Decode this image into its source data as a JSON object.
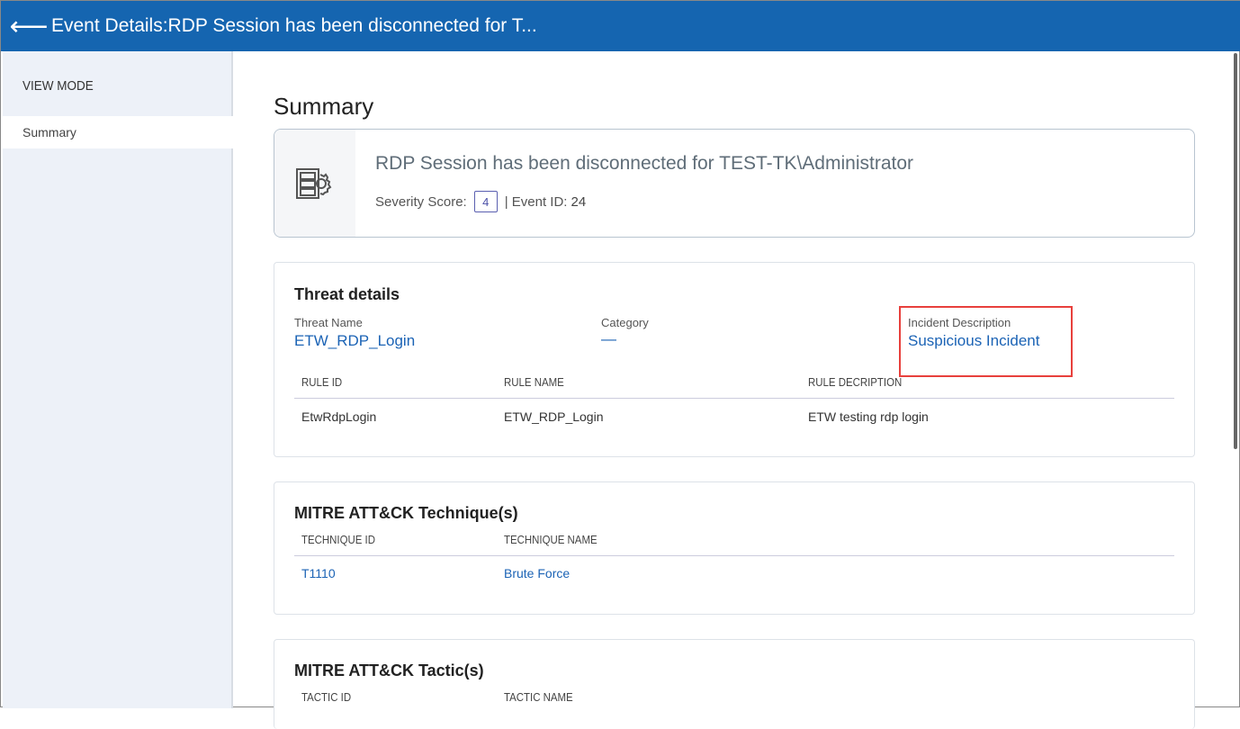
{
  "header": {
    "title": "Event Details:RDP Session has been disconnected for T...",
    "back_icon": "arrow-left-icon"
  },
  "sidebar": {
    "section": "VIEW MODE",
    "items": [
      {
        "label": "Summary"
      }
    ]
  },
  "summary": {
    "heading": "Summary",
    "event_title": "RDP Session has been disconnected for TEST-TK\\Administrator",
    "severity_label": "Severity Score:",
    "severity_value": "4",
    "event_id_label": "| Event ID:",
    "event_id": "24"
  },
  "threat": {
    "title": "Threat details",
    "threat_name_label": "Threat Name",
    "threat_name": "ETW_RDP_Login",
    "category_label": "Category",
    "category": "—",
    "incident_label": "Incident Description",
    "incident": "Suspicious Incident",
    "columns": [
      "RULE ID",
      "RULE NAME",
      "RULE DECRIPTION"
    ],
    "rows": [
      [
        "EtwRdpLogin",
        "ETW_RDP_Login",
        "ETW testing rdp login"
      ]
    ]
  },
  "technique": {
    "title": "MITRE ATT&CK Technique(s)",
    "columns": [
      "TECHNIQUE ID",
      "TECHNIQUE NAME"
    ],
    "rows": [
      [
        "T1110",
        "Brute Force"
      ]
    ]
  },
  "tactic": {
    "title": "MITRE ATT&CK Tactic(s)",
    "columns": [
      "TACTIC ID",
      "TACTIC NAME"
    ]
  }
}
